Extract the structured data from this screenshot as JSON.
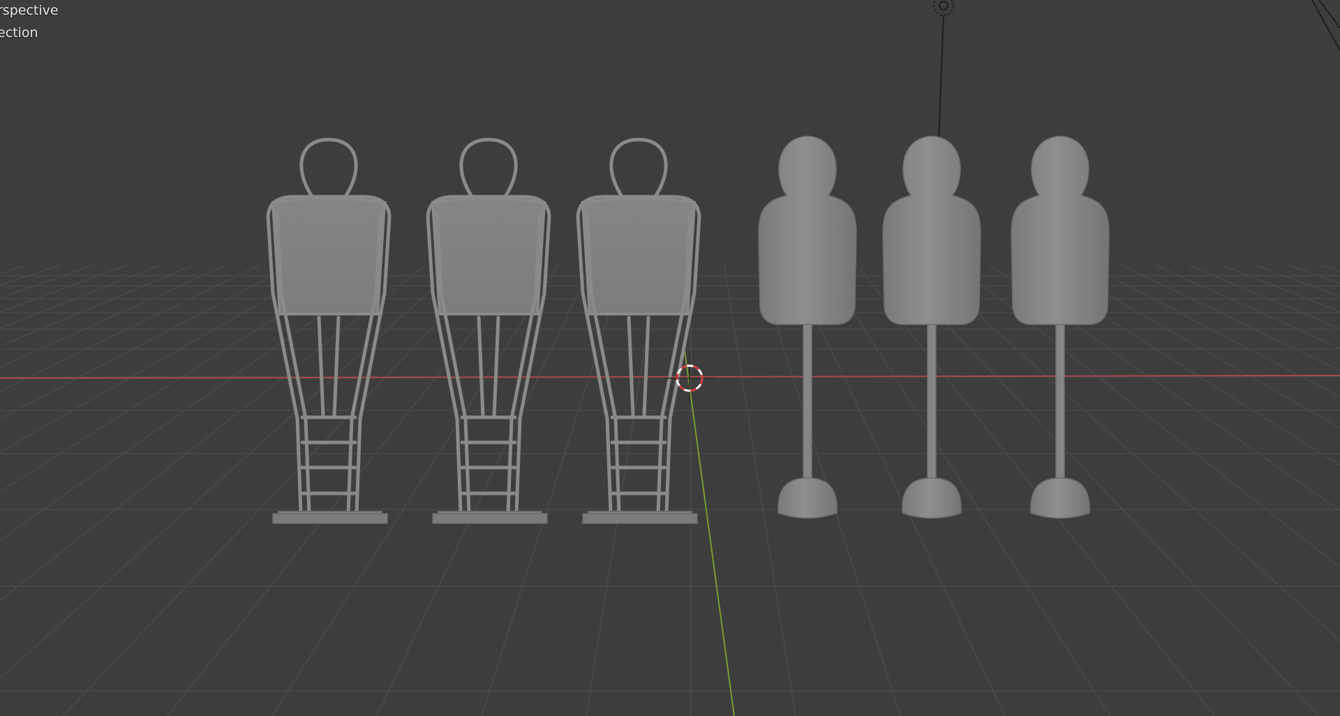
{
  "viewport": {
    "view_mode_label": "rspective",
    "collection_label": "ection"
  },
  "colors": {
    "background": "#3d3d3d",
    "grid": "#4a4a4a",
    "x_axis": "#a8484f",
    "y_axis": "#7a9a32",
    "object": "#8a8a8a",
    "cursor_red": "#c83a3a"
  },
  "objects": {
    "frame_mannequins": 3,
    "solid_mannequins": 3
  },
  "icons": [
    "light-icon",
    "camera-icon",
    "3d-cursor-icon"
  ]
}
